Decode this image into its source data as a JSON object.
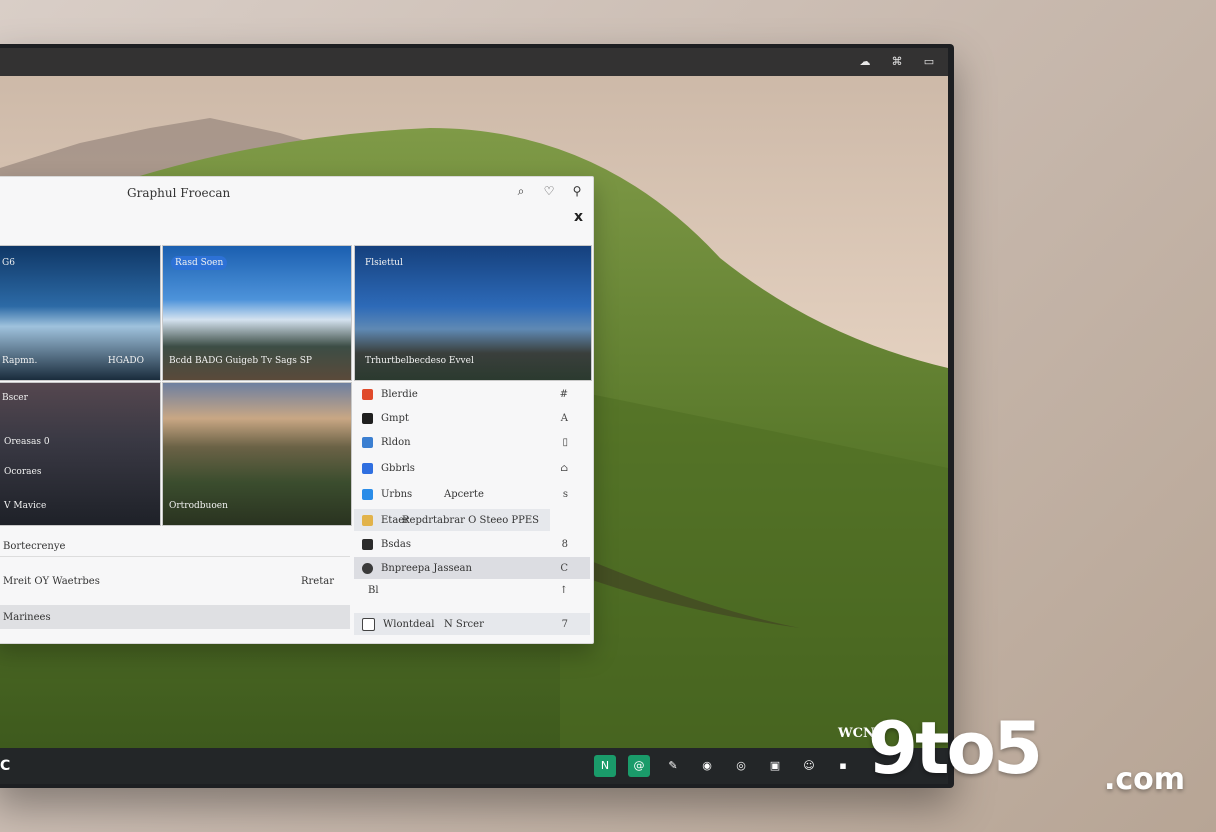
{
  "window": {
    "title": "Graphul Froecan",
    "top_icons": [
      "search-icon",
      "heart-icon",
      "location-icon"
    ],
    "close_glyph": "x"
  },
  "topbar": {
    "icons": [
      "cloud-icon",
      "network-icon",
      "battery-icon"
    ]
  },
  "tiles": [
    {
      "top_label": "G6",
      "bottom_left": "Rapmn.",
      "bottom_right": "HGADO"
    },
    {
      "top_label": "Rasd Soen",
      "bottom": "Bcdd BADG Guigeb Tv Sags SP"
    },
    {
      "top_label": "Flsiettul",
      "bottom": "Trhurtbelbecdeso Evvel"
    },
    {
      "top_label": "Bscer",
      "rows": [
        "Oreasas 0",
        "Ocoraes",
        "V Mavice"
      ]
    },
    {
      "bottom": "Ortrodbuoen"
    }
  ],
  "list": [
    {
      "label": "Blerdie",
      "right": "#",
      "color": "#e04a2a"
    },
    {
      "label": "Gmpt",
      "right": "A",
      "color": "#1f1f1f"
    },
    {
      "label": "Rldon",
      "right": "▯",
      "color": "#3b7fd1"
    },
    {
      "label": "Gbbrls",
      "right": "⌂",
      "color": "#2f6fe0"
    },
    {
      "label": "Urbns",
      "mid": "Apcerte",
      "right": "s",
      "color": "#2a8ce8"
    },
    {
      "label": "Etaer",
      "mid": "Repdrtabrar O Steeo PPES",
      "right": "",
      "color": "#e2b34a"
    },
    {
      "label": "Bsdas",
      "right": "8",
      "color": "#2b2b2b"
    },
    {
      "label": "Bnpreepa Jassean",
      "right": "C",
      "color": "#3a3a3a"
    },
    {
      "label": "Bl",
      "right": "↑",
      "color": "#555"
    },
    {
      "label": "Wlontdeal",
      "mid": "N Srcer",
      "right": "7",
      "color": "#444"
    }
  ],
  "bottom_left": {
    "row1": "Bortecrenye",
    "row2": "Mreit OY Waetrbes",
    "row2_right": "Rretar",
    "row3": "Marinees"
  },
  "taskbar": {
    "start": "C",
    "apps": [
      "N",
      "@",
      "✎",
      "◉",
      "◎",
      "▣",
      "☺",
      "▪"
    ],
    "corner_text": "WCN"
  },
  "watermark": {
    "main": "9to5",
    "suffix": ".com"
  },
  "colors": {
    "taskbar": "#232628",
    "panel_bg": "#f7f7f8",
    "green_app": "#1a9b6a"
  }
}
